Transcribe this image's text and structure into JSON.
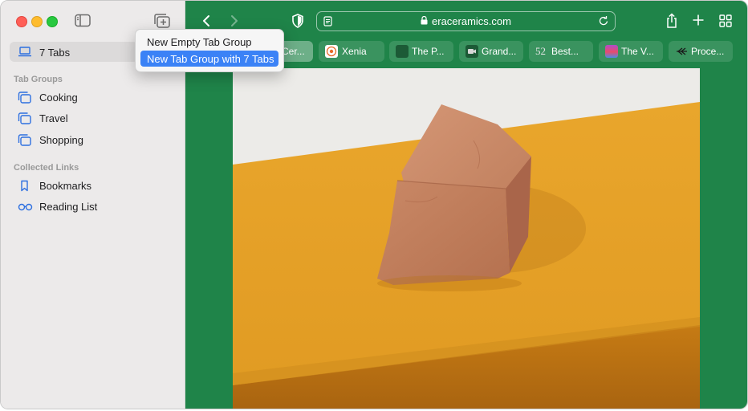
{
  "sidebar": {
    "current": {
      "label": "7 Tabs",
      "icon": "laptop-icon"
    },
    "tab_groups_heading": "Tab Groups",
    "tab_groups": [
      {
        "label": "Cooking",
        "icon": "tab-group-icon"
      },
      {
        "label": "Travel",
        "icon": "tab-group-icon"
      },
      {
        "label": "Shopping",
        "icon": "tab-group-icon"
      }
    ],
    "collected_heading": "Collected Links",
    "collected": [
      {
        "label": "Bookmarks",
        "icon": "bookmark-icon"
      },
      {
        "label": "Reading List",
        "icon": "glasses-icon"
      }
    ]
  },
  "popup_menu": {
    "items": [
      {
        "label": "New Empty Tab Group",
        "selected": false
      },
      {
        "label": "New Tab Group with 7 Tabs",
        "selected": true
      }
    ]
  },
  "toolbar": {
    "url": "eraceramics.com",
    "accent": "#1f8449"
  },
  "tabs": [
    {
      "label": "Cer...",
      "active": true
    },
    {
      "label": "Xenia"
    },
    {
      "label": "The P..."
    },
    {
      "label": "Grand..."
    },
    {
      "label": "Best...",
      "favicon_text": "52"
    },
    {
      "label": "The V..."
    },
    {
      "label": "Proce..."
    }
  ],
  "colors": {
    "sidebar_bg": "#eceaea",
    "toolbar_green": "#1f8449",
    "menu_highlight": "#3b82f6",
    "clay": "#c17f62",
    "orange_surface": "#e5a12a"
  }
}
